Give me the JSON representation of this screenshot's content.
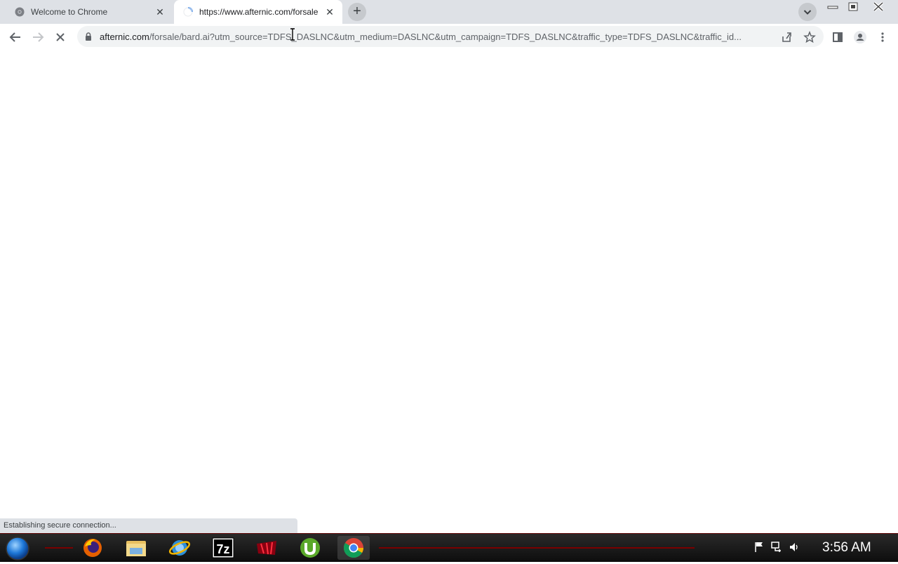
{
  "browser": {
    "tabs": [
      {
        "title": "Welcome to Chrome",
        "active": false
      },
      {
        "title": "https://www.afternic.com/forsale",
        "active": true,
        "loading": true
      }
    ],
    "address": {
      "host": "afternic.com",
      "path": "/forsale/bard.ai?utm_source=TDFS_DASLNC&utm_medium=DASLNC&utm_campaign=TDFS_DASLNC&traffic_type=TDFS_DASLNC&traffic_id..."
    },
    "status_text": "Establishing secure connection...",
    "icons": [
      "back-icon",
      "forward-icon",
      "stop-icon",
      "lock-icon",
      "share-icon",
      "star-icon",
      "side-panel-icon",
      "profile-icon",
      "menu-icon"
    ]
  },
  "taskbar": {
    "apps": [
      "firefox",
      "file-explorer",
      "ie-browser",
      "7zip",
      "red-app",
      "utorrent",
      "chrome"
    ],
    "active_app": "chrome",
    "clock": "3:56 AM",
    "tray_icons": [
      "flag-icon",
      "network-icon",
      "volume-icon"
    ]
  },
  "colors": {
    "tab_strip": "#dee1e6",
    "taskbar": "#111111",
    "accent_red": "#7a0000"
  }
}
